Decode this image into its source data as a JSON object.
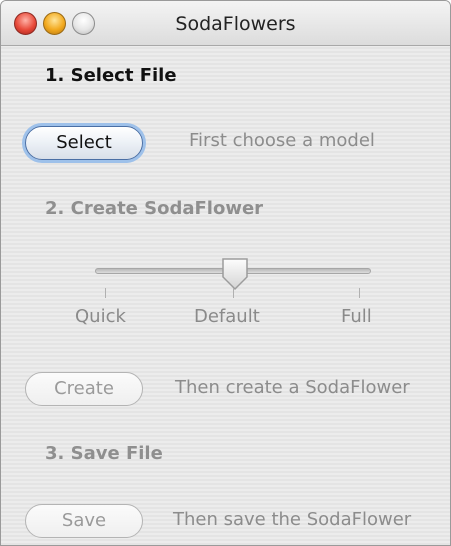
{
  "window": {
    "title": "SodaFlowers"
  },
  "step1": {
    "heading": "1. Select File",
    "button_label": "Select",
    "hint": "First choose a model"
  },
  "step2": {
    "heading": "2. Create SodaFlower",
    "slider": {
      "ticks": [
        "Quick",
        "Default",
        "Full"
      ],
      "selected": "Default",
      "value": 0.5
    },
    "button_label": "Create",
    "hint": "Then create a SodaFlower"
  },
  "step3": {
    "heading": "3. Save File",
    "button_label": "Save",
    "hint": "Then save the SodaFlower"
  }
}
